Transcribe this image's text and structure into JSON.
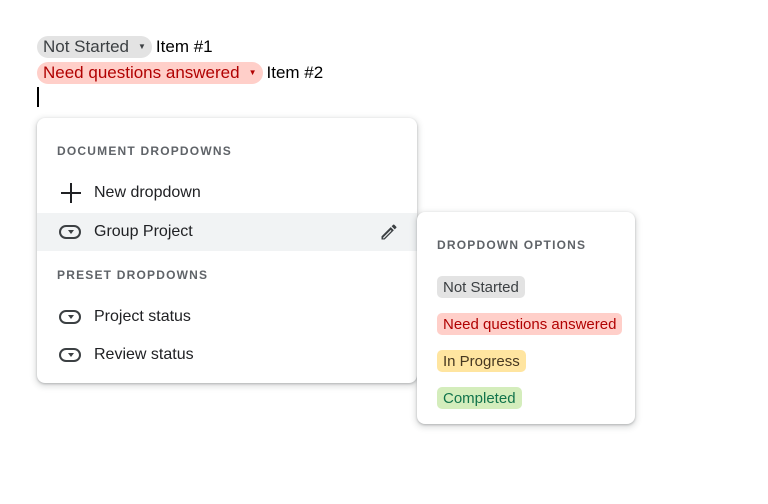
{
  "document": {
    "lines": [
      {
        "chip_label": "Not Started",
        "item_text": "Item #1",
        "chip_color": "#e3e3e3",
        "chip_text_color": "#3c4043"
      },
      {
        "chip_label": "Need questions answered",
        "item_text": "Item #2",
        "chip_color": "#ffcfc9",
        "chip_text_color": "#b10202"
      }
    ]
  },
  "main_menu": {
    "document_section_title": "DOCUMENT DROPDOWNS",
    "new_dropdown_label": "New dropdown",
    "document_items": [
      {
        "label": "Group Project",
        "icon": "dropdown-chip-icon",
        "highlighted": true,
        "edit_icon": "pencil-icon"
      }
    ],
    "preset_section_title": "PRESET DROPDOWNS",
    "preset_items": [
      {
        "label": "Project status",
        "icon": "dropdown-chip-icon"
      },
      {
        "label": "Review status",
        "icon": "dropdown-chip-icon"
      }
    ]
  },
  "options_menu": {
    "title": "DROPDOWN OPTIONS",
    "options": [
      {
        "label": "Not Started",
        "bg": "#e3e3e3",
        "fg": "#3c4043"
      },
      {
        "label": "Need questions answered",
        "bg": "#ffcfc9",
        "fg": "#b10202"
      },
      {
        "label": "In Progress",
        "bg": "#ffe5a0",
        "fg": "#473821"
      },
      {
        "label": "Completed",
        "bg": "#d4edbc",
        "fg": "#11734b"
      }
    ]
  }
}
